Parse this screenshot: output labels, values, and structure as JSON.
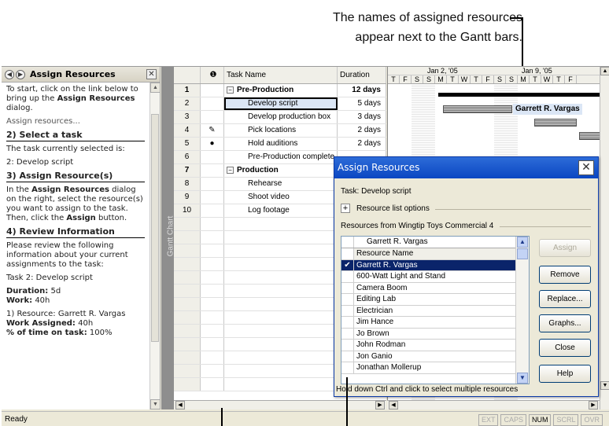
{
  "callout": {
    "line1": "The names of assigned resources",
    "line2": "appear next to the Gantt bars."
  },
  "taskpane": {
    "title": "Assign Resources",
    "intro": "To start, click on the link below to bring up the",
    "intro_bold": "Assign Resources",
    "intro_end": "dialog.",
    "link": "Assign resources...",
    "s2_heading": "2) Select a task",
    "s2_text": "The task currently selected is:",
    "s2_task": "2: Develop script",
    "s3_heading": "3) Assign Resource(s)",
    "s3_text_a": "In the",
    "s3_bold_a": "Assign Resources",
    "s3_text_b": "dialog on the right, select the resource(s) you want to assign to the task. Then, click the",
    "s3_bold_b": "Assign",
    "s3_text_c": "button.",
    "s4_heading": "4) Review Information",
    "s4_text": "Please review the following information about your current assignments to the task:",
    "s4_task": "Task 2: Develop script",
    "duration_label": "Duration:",
    "duration_val": "5d",
    "work_label": "Work:",
    "work_val": "40h",
    "res_line": "1) Resource: Garrett R. Vargas",
    "work_assigned_label": "Work Assigned:",
    "work_assigned_val": "40h",
    "pct_label": "% of time on task:",
    "pct_val": "100%"
  },
  "viewbar": {
    "label": "Gantt Chart"
  },
  "grid": {
    "headers": {
      "name": "Task Name",
      "duration": "Duration"
    },
    "rows": [
      {
        "id": "1",
        "name": "Pre-Production",
        "duration": "12 days"
      },
      {
        "id": "2",
        "name": "Develop script",
        "duration": "5 days"
      },
      {
        "id": "3",
        "name": "Develop production box",
        "duration": "3 days"
      },
      {
        "id": "4",
        "name": "Pick locations",
        "duration": "2 days"
      },
      {
        "id": "5",
        "name": "Hold auditions",
        "duration": "2 days"
      },
      {
        "id": "6",
        "name": "Pre-Production complete",
        "duration": ""
      },
      {
        "id": "7",
        "name": "Production",
        "duration": ""
      },
      {
        "id": "8",
        "name": "Rehearse",
        "duration": ""
      },
      {
        "id": "9",
        "name": "Shoot video",
        "duration": ""
      },
      {
        "id": "10",
        "name": "Log footage",
        "duration": ""
      }
    ]
  },
  "gantt": {
    "week1": "Jan 2, '05",
    "week2": "Jan 9, '05",
    "days": [
      "T",
      "F",
      "S",
      "S",
      "M",
      "T",
      "W",
      "T",
      "F",
      "S",
      "S",
      "M",
      "T",
      "W",
      "T",
      "F"
    ],
    "resource_label": "Garrett R. Vargas"
  },
  "dialog": {
    "title": "Assign Resources",
    "task_label": "Task: Develop script",
    "options_label": "Resource list options",
    "from_label": "Resources from Wingtip Toys Commercial 4",
    "edit_value": "Garrett R. Vargas",
    "column_header": "Resource Name",
    "resources": [
      "Garrett R. Vargas",
      "600-Watt Light and Stand",
      "Camera Boom",
      "Editing Lab",
      "Electrician",
      "Jim Hance",
      "Jo Brown",
      "John Rodman",
      "Jon Ganio",
      "Jonathan Mollerup"
    ],
    "buttons": {
      "assign": "Assign",
      "remove": "Remove",
      "replace": "Replace...",
      "graphs": "Graphs...",
      "close": "Close",
      "help": "Help"
    },
    "footer": "Hold down Ctrl and click to select multiple resources"
  },
  "status": {
    "ready": "Ready",
    "indicators": [
      "EXT",
      "CAPS",
      "NUM",
      "SCRL",
      "OVR"
    ],
    "active": "NUM"
  }
}
